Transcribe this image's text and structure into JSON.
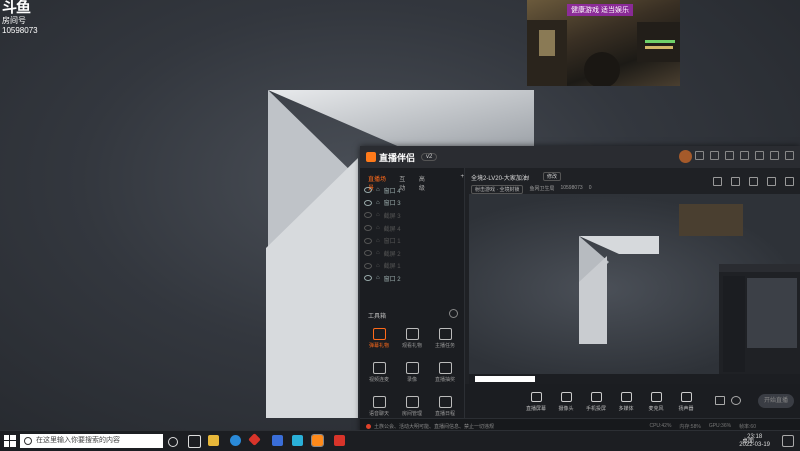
{
  "watermark": {
    "brand": "斗鱼",
    "sub": "房间号",
    "room_id": "10598073"
  },
  "game_preview": {
    "banner": "健康游戏 适当娱乐"
  },
  "app": {
    "title": "直播伴侣",
    "version": "v2",
    "left_tabs": [
      "直播场景",
      "互动",
      "高级"
    ],
    "scenes": [
      {
        "label": "窗口 4",
        "dim": false
      },
      {
        "label": "窗口 3",
        "dim": false
      },
      {
        "label": "截屏 3",
        "dim": true
      },
      {
        "label": "截屏 4",
        "dim": true
      },
      {
        "label": "窗口 1",
        "dim": true
      },
      {
        "label": "截屏 2",
        "dim": true
      },
      {
        "label": "截屏 1",
        "dim": true
      },
      {
        "label": "窗口 2",
        "dim": false
      }
    ],
    "tools_title": "工具箱",
    "tools": [
      {
        "label": "弹幕礼物",
        "on": true
      },
      {
        "label": "观看礼物",
        "on": false
      },
      {
        "label": "主播任务",
        "on": false
      },
      {
        "label": "视频连麦",
        "on": false
      },
      {
        "label": "录像",
        "on": false
      },
      {
        "label": "直播抽奖",
        "on": false
      },
      {
        "label": "语音聊天",
        "on": false
      },
      {
        "label": "房间管理",
        "on": false
      },
      {
        "label": "直播日程",
        "on": false
      }
    ],
    "room": {
      "title": "全境2-LV20-大家加油!",
      "edit_btn": "修改",
      "category": "射击游戏 · 全境封锁",
      "room_label": "鱼网卫生局",
      "room_id": "10598073",
      "hot": "0"
    },
    "bottom_tools": [
      "直播屏幕",
      "摄像头",
      "手机投屏",
      "多媒体",
      "麦克风",
      "扬声器"
    ],
    "start_button": "开始直播",
    "notice": "土族公会、活动大明可能、直播间信息、禁止一切违规",
    "stats": [
      "CPU:42%",
      "内存:58%",
      "GPU:36%",
      "帧率:60"
    ]
  },
  "taskbar": {
    "search_placeholder": "在这里输入你要搜索的内容",
    "tray_text": "桌面",
    "time": "23:18",
    "date": "2022-03-19"
  }
}
